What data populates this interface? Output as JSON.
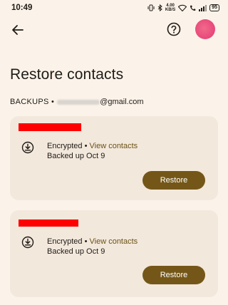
{
  "status_bar": {
    "time": "10:49",
    "speed_top": "4.00",
    "speed_bottom": "KB/S",
    "battery": "95"
  },
  "app_bar": {
    "back_icon": "arrow-back-icon",
    "help_icon": "help-circle-icon",
    "avatar_color": "#e8477a"
  },
  "page": {
    "title": "Restore contacts",
    "backups_label": "BACKUPS •",
    "email_suffix": "@gmail.com"
  },
  "backups": [
    {
      "status": "Encrypted •",
      "view_link": "View contacts",
      "date": "Backed up Oct 9",
      "restore_label": "Restore"
    },
    {
      "status": "Encrypted •",
      "view_link": "View contacts",
      "date": "Backed up Oct 9",
      "restore_label": "Restore"
    }
  ],
  "colors": {
    "background": "#fbf3ea",
    "card": "#f3e8dc",
    "accent": "#745718",
    "link": "#6a5216",
    "redaction": "#ff0000"
  }
}
